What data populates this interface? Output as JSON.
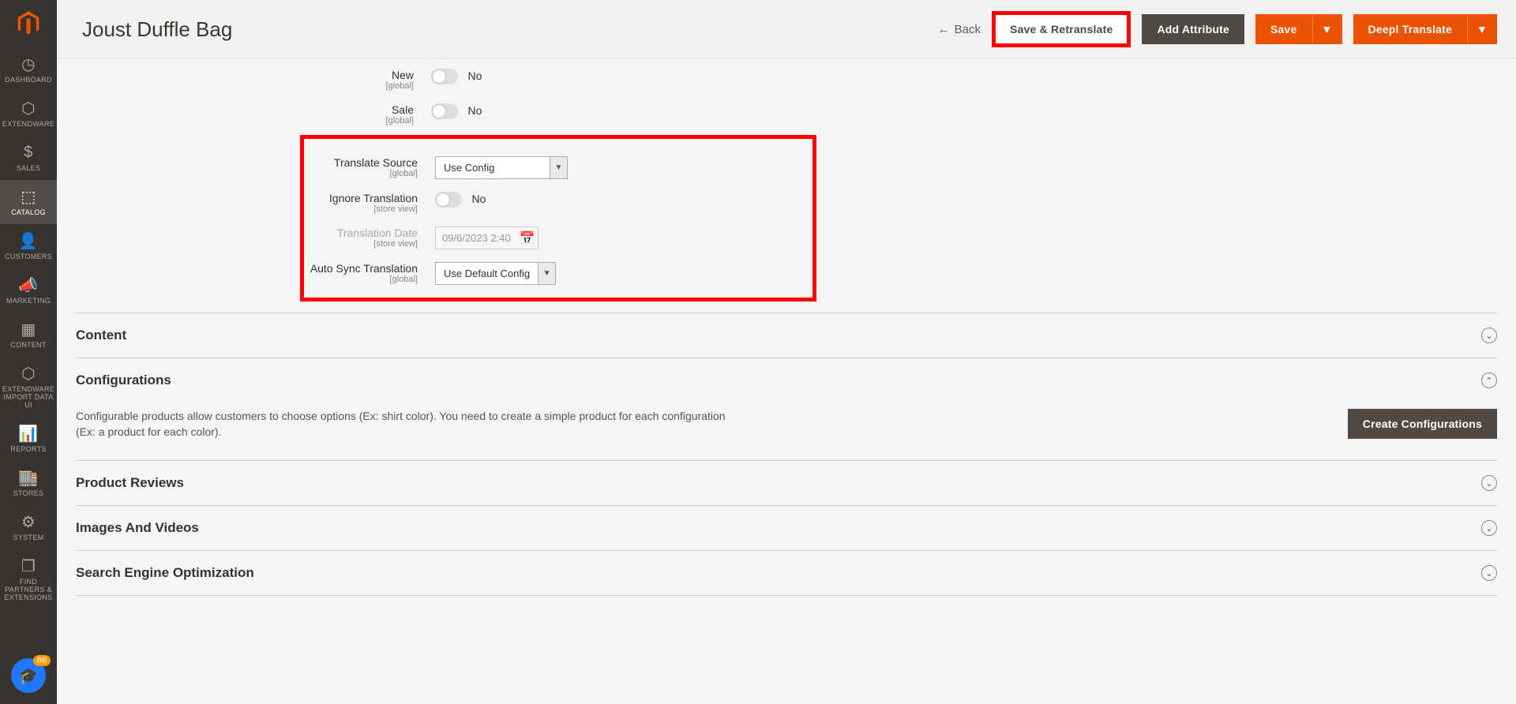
{
  "header": {
    "title": "Joust Duffle Bag",
    "back": "Back",
    "save_retranslate": "Save & Retranslate",
    "add_attribute": "Add Attribute",
    "save": "Save",
    "deepl_translate": "Deepl Translate"
  },
  "sidebar": {
    "items": [
      {
        "label": "DASHBOARD"
      },
      {
        "label": "EXTENDWARE"
      },
      {
        "label": "SALES"
      },
      {
        "label": "CATALOG"
      },
      {
        "label": "CUSTOMERS"
      },
      {
        "label": "MARKETING"
      },
      {
        "label": "CONTENT"
      },
      {
        "label": "EXTENDWARE IMPORT DATA UI"
      },
      {
        "label": "REPORTS"
      },
      {
        "label": "STORES"
      },
      {
        "label": "SYSTEM"
      },
      {
        "label": "FIND PARTNERS & EXTENSIONS"
      }
    ]
  },
  "fields": {
    "new": {
      "label": "New",
      "scope": "[global]",
      "value": "No"
    },
    "sale": {
      "label": "Sale",
      "scope": "[global]",
      "value": "No"
    },
    "translate_source": {
      "label": "Translate Source",
      "scope": "[global]",
      "value": "Use Config"
    },
    "ignore_translation": {
      "label": "Ignore Translation",
      "scope": "[store view]",
      "value": "No"
    },
    "translation_date": {
      "label": "Translation Date",
      "scope": "[store view]",
      "value": "09/6/2023 2:40 "
    },
    "auto_sync": {
      "label": "Auto Sync Translation",
      "scope": "[global]",
      "value": "Use Default Config"
    }
  },
  "sections": {
    "content": "Content",
    "configurations": "Configurations",
    "config_desc": "Configurable products allow customers to choose options (Ex: shirt color). You need to create a simple product for each configuration (Ex: a product for each color).",
    "create_config": "Create Configurations",
    "product_reviews": "Product Reviews",
    "images_videos": "Images And Videos",
    "seo": "Search Engine Optimization"
  },
  "fab_badge": "66"
}
